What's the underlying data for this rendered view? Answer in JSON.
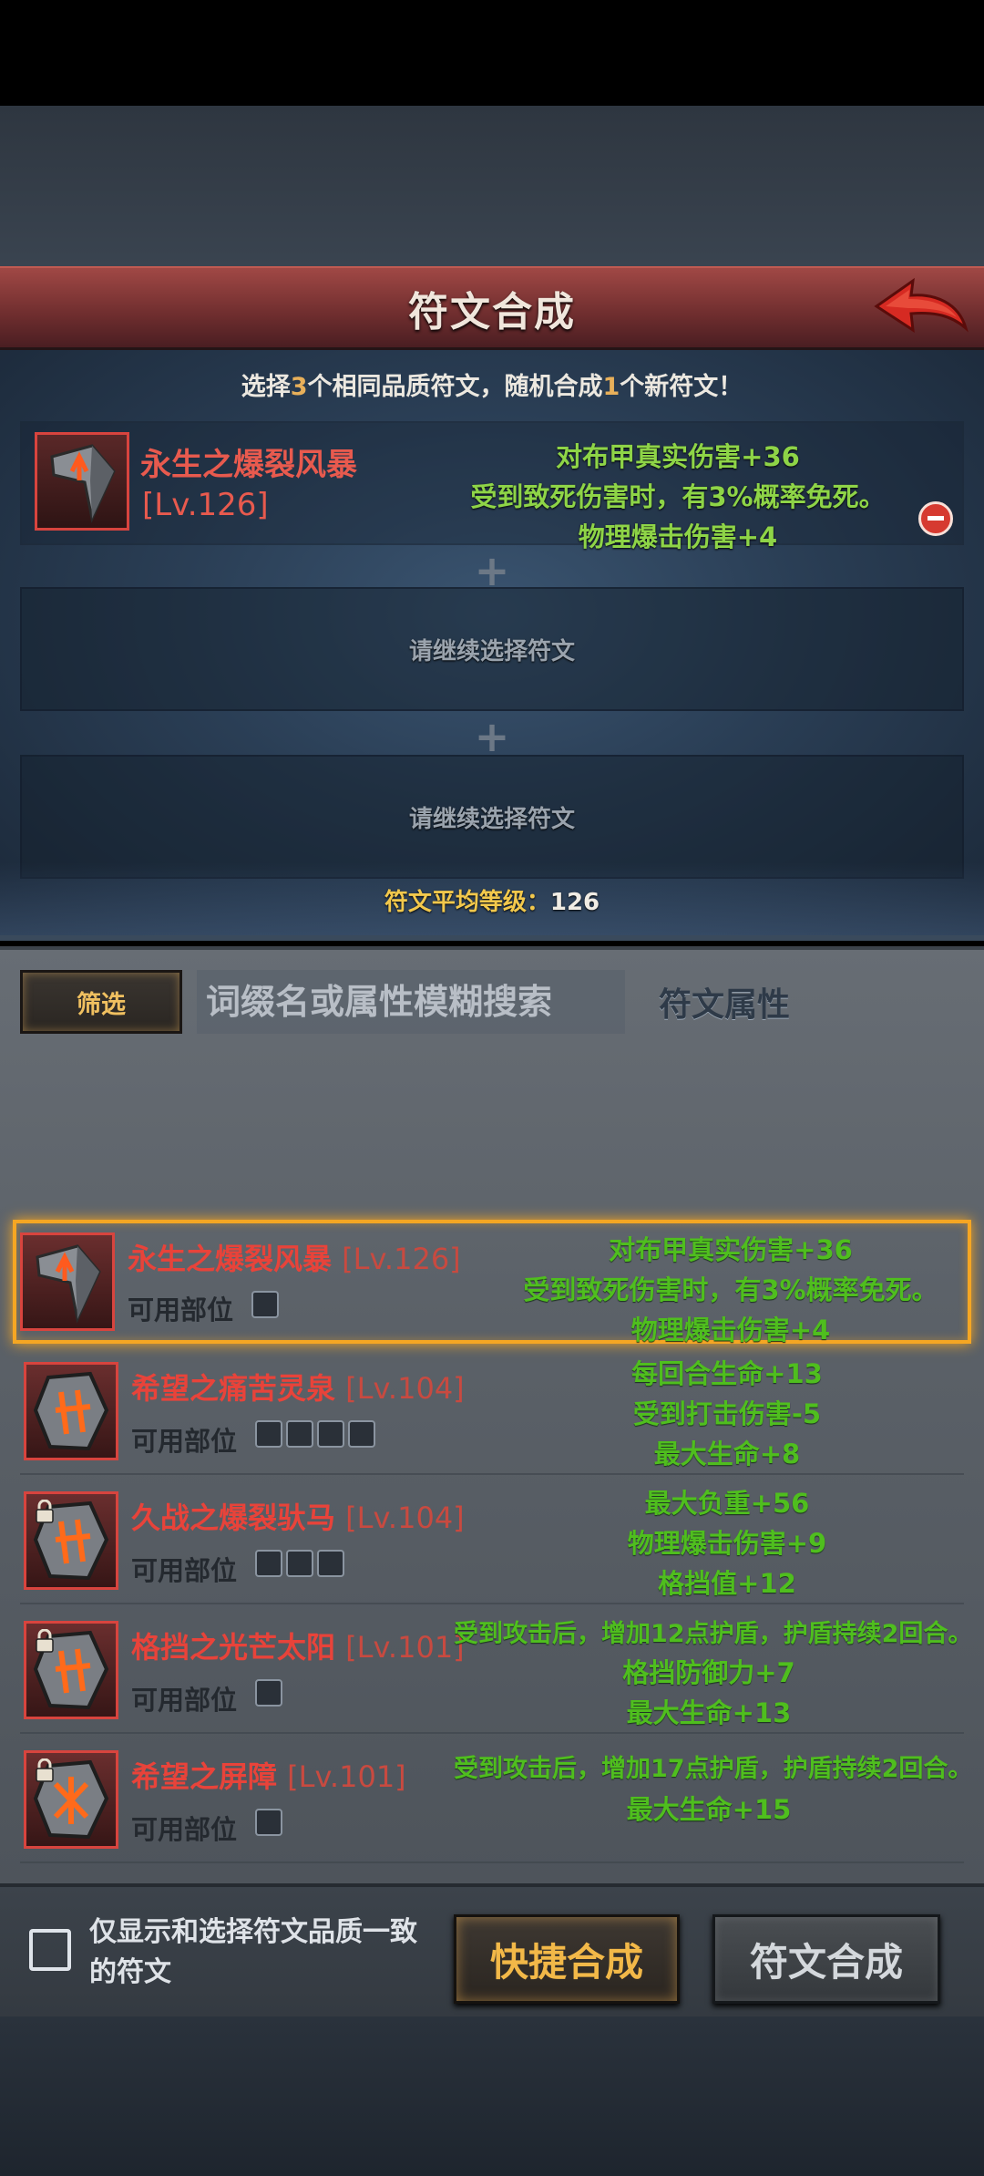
{
  "header": {
    "title": "符文合成"
  },
  "synthesis": {
    "instruction_parts": [
      "选择",
      "3",
      "个相同品质符文，随机合成",
      "1",
      "个新符文！"
    ],
    "selected_rune": {
      "name": "永生之爆裂风暴",
      "level": "[Lv.126]",
      "stats": [
        "对布甲真实伤害+36",
        "受到致死伤害时，有3%概率免死。",
        "物理爆击伤害+4"
      ]
    },
    "empty_slot_label": "请继续选择符文",
    "avg_level_label": "符文平均等级：",
    "avg_level_value": "126"
  },
  "filter": {
    "filter_label": "筛选",
    "search_placeholder": "词缀名或属性模糊搜索",
    "attribute_label": "符文属性"
  },
  "rune_list": [
    {
      "name": "永生之爆裂风暴",
      "level": "[Lv.126]",
      "parts_label": "可用部位",
      "part_icon_count": 1,
      "locked": false,
      "selected": true,
      "stats": [
        "对布甲真实伤害+36",
        "受到致死伤害时，有3%概率免死。",
        "物理爆击伤害+4"
      ]
    },
    {
      "name": "希望之痛苦灵泉",
      "level": "[Lv.104]",
      "parts_label": "可用部位",
      "part_icon_count": 4,
      "locked": false,
      "selected": false,
      "stats": [
        "每回合生命+13",
        "受到打击伤害-5",
        "最大生命+8"
      ]
    },
    {
      "name": "久战之爆裂驮马",
      "level": "[Lv.104]",
      "parts_label": "可用部位",
      "part_icon_count": 3,
      "locked": true,
      "selected": false,
      "stats": [
        "最大负重+56",
        "物理爆击伤害+9",
        "格挡值+12"
      ]
    },
    {
      "name": "格挡之光芒太阳",
      "level": "[Lv.101]",
      "parts_label": "可用部位",
      "part_icon_count": 1,
      "locked": true,
      "selected": false,
      "stats": [
        "受到攻击后，增加12点护盾，护盾持续2回合。",
        "格挡防御力+7",
        "最大生命+13"
      ]
    },
    {
      "name": "希望之屏障",
      "level": "[Lv.101]",
      "parts_label": "可用部位",
      "part_icon_count": 1,
      "locked": true,
      "selected": false,
      "stats": [
        "受到攻击后，增加17点护盾，护盾持续2回合。",
        "最大生命+15"
      ]
    }
  ],
  "bottom": {
    "checkbox_label": "仅显示和选择符文品质一致的符文",
    "quick_synth_label": "快捷合成",
    "synth_label": "符文合成"
  },
  "colors": {
    "rune_name": "#e8433a",
    "stat_green": "#4fbe1e",
    "accent_gold": "#f2b848",
    "selected_border": "#f5a623"
  }
}
